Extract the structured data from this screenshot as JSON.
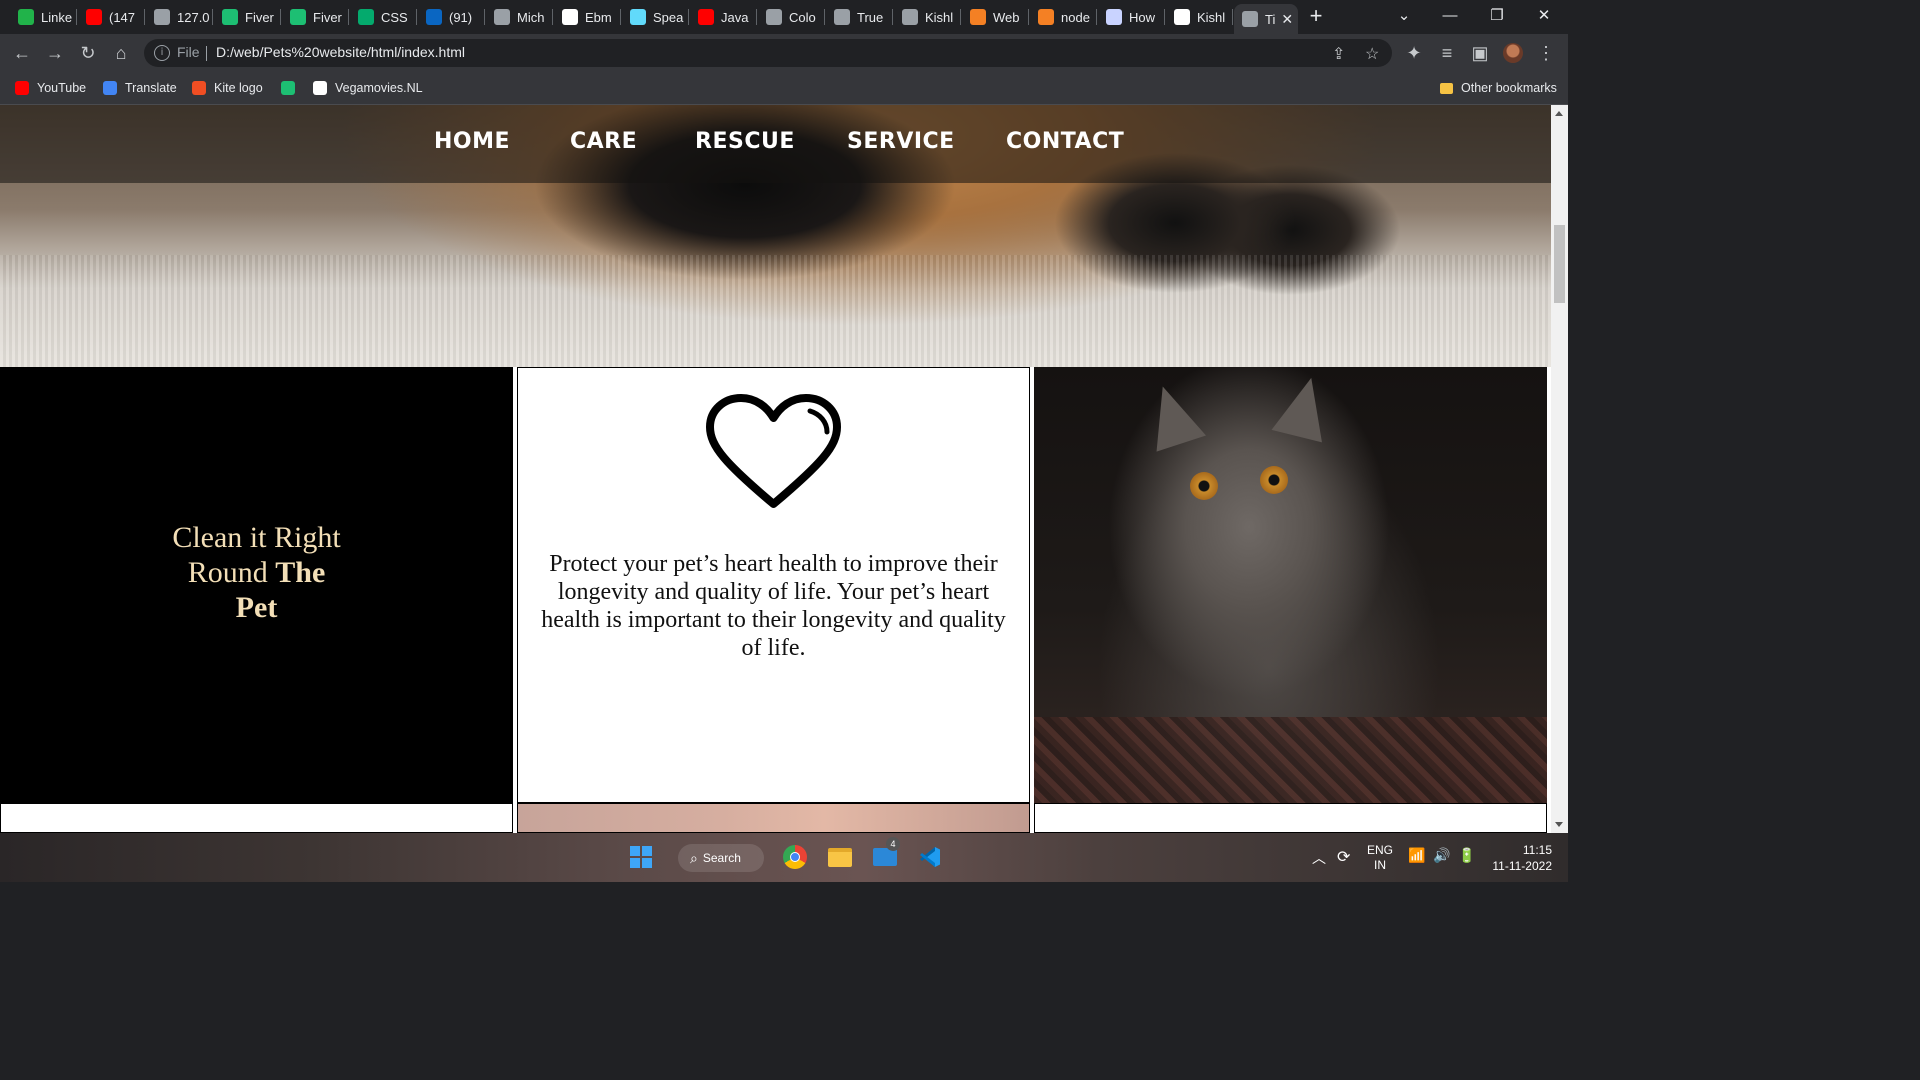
{
  "browser": {
    "tabs": [
      {
        "label": "Linke",
        "icon": "linkedin-green-icon",
        "color": "#21b34a"
      },
      {
        "label": "(147",
        "icon": "youtube-icon",
        "color": "#ff0000"
      },
      {
        "label": "127.0",
        "icon": "globe-icon",
        "color": "#9aa0a6"
      },
      {
        "label": "Fiver",
        "icon": "fiverr-icon",
        "color": "#1dbf73"
      },
      {
        "label": "Fiver",
        "icon": "fiverr-icon",
        "color": "#1dbf73"
      },
      {
        "label": "CSS",
        "icon": "w3schools-icon",
        "color": "#04aa6d"
      },
      {
        "label": "(91)",
        "icon": "linkedin-icon",
        "color": "#0a66c2"
      },
      {
        "label": "Mich",
        "icon": "globe-icon",
        "color": "#9aa0a6"
      },
      {
        "label": "Ebm",
        "icon": "github-icon",
        "color": "#ffffff"
      },
      {
        "label": "Spea",
        "icon": "react-icon",
        "color": "#61dafb"
      },
      {
        "label": "Java",
        "icon": "youtube-icon",
        "color": "#ff0000"
      },
      {
        "label": "Colo",
        "icon": "globe-icon",
        "color": "#9aa0a6"
      },
      {
        "label": "True",
        "icon": "globe-icon",
        "color": "#9aa0a6"
      },
      {
        "label": "Kishl",
        "icon": "globe-icon",
        "color": "#9aa0a6"
      },
      {
        "label": "Web",
        "icon": "stackoverflow-icon",
        "color": "#f48024"
      },
      {
        "label": "node",
        "icon": "stackoverflow-icon",
        "color": "#f48024"
      },
      {
        "label": "How",
        "icon": "arc-icon",
        "color": "#c9d3ff"
      },
      {
        "label": "Kishl",
        "icon": "github-icon",
        "color": "#ffffff"
      },
      {
        "label": "Ti",
        "icon": "globe-icon",
        "color": "#9aa0a6",
        "active": true
      }
    ],
    "address": {
      "scheme": "File",
      "url": "D:/web/Pets%20website/html/index.html"
    },
    "bookmarks": [
      {
        "label": "YouTube",
        "icon": "youtube-icon",
        "color": "#ff0000"
      },
      {
        "label": "Translate",
        "icon": "translate-icon",
        "color": "#4285f4"
      },
      {
        "label": "Kite logo",
        "icon": "kite-icon",
        "color": "#f04e23"
      },
      {
        "label": "",
        "icon": "fiverr-icon",
        "color": "#1dbf73"
      },
      {
        "label": "Vegamovies.NL",
        "icon": "vegamovies-icon",
        "color": "#ffffff"
      }
    ],
    "other_bookmarks": "Other bookmarks"
  },
  "page": {
    "nav": [
      "HOME",
      "CARE",
      "RESCUE",
      "SERVICE",
      "CONTACT"
    ],
    "card_title": {
      "line1": "Clean it Right",
      "line2a": "Round ",
      "line2b": "The",
      "line3": "Pet"
    },
    "card_text": "Protect your pet’s heart health to improve their longevity and quality of life. Your pet’s heart health is important to their longevity and quality of life.",
    "title_color": "#f3dfb7"
  },
  "taskbar": {
    "search_label": "Search",
    "mail_badge": "4",
    "language": "ENG",
    "region": "IN",
    "time": "11:15",
    "date": "11-11-2022"
  }
}
